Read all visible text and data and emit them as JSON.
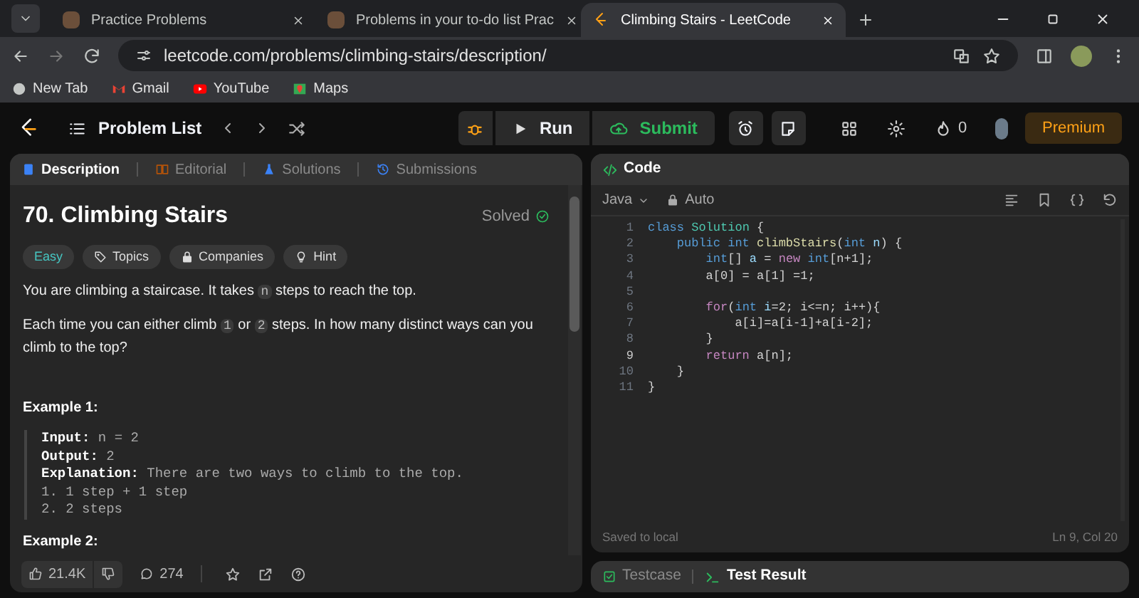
{
  "browser": {
    "tabs": [
      {
        "title": "Practice Problems",
        "selected": false
      },
      {
        "title": "Problems in your to-do list Prac",
        "selected": false
      },
      {
        "title": "Climbing Stairs - LeetCode",
        "selected": true
      }
    ],
    "url": "leetcode.com/problems/climbing-stairs/description/",
    "bookmarks": [
      {
        "label": "New Tab"
      },
      {
        "label": "Gmail"
      },
      {
        "label": "YouTube"
      },
      {
        "label": "Maps"
      }
    ]
  },
  "header": {
    "problem_list": "Problem List",
    "run": "Run",
    "submit": "Submit",
    "streak": "0",
    "premium": "Premium"
  },
  "left_panel": {
    "tabs": [
      {
        "label": "Description",
        "selected": true
      },
      {
        "label": "Editorial",
        "selected": false
      },
      {
        "label": "Solutions",
        "selected": false
      },
      {
        "label": "Submissions",
        "selected": false
      }
    ],
    "title": "70. Climbing Stairs",
    "status": "Solved",
    "chips": [
      {
        "label": "Easy",
        "kind": "difficulty"
      },
      {
        "label": "Topics",
        "kind": "tag"
      },
      {
        "label": "Companies",
        "kind": "lock"
      },
      {
        "label": "Hint",
        "kind": "bulb"
      }
    ],
    "paragraphs": [
      [
        {
          "t": "You are climbing a staircase. It takes "
        },
        {
          "t": "n",
          "code": true
        },
        {
          "t": " steps to reach the top."
        }
      ],
      [
        {
          "t": "Each time you can either climb "
        },
        {
          "t": "1",
          "code": true
        },
        {
          "t": " or "
        },
        {
          "t": "2",
          "code": true
        },
        {
          "t": " steps. In how many distinct ways can you climb to the top?"
        }
      ]
    ],
    "examples": [
      {
        "heading": "Example 1:",
        "lines": [
          {
            "label": "Input:",
            "value": "n = 2"
          },
          {
            "label": "Output:",
            "value": "2"
          },
          {
            "label": "Explanation:",
            "value": "There are two ways to climb to the top."
          },
          {
            "value": "1. 1 step + 1 step"
          },
          {
            "value": "2. 2 steps"
          }
        ]
      },
      {
        "heading": "Example 2:"
      }
    ],
    "footer": {
      "likes": "21.4K",
      "comments": "274"
    }
  },
  "code_panel": {
    "title": "Code",
    "language": "Java",
    "mode": "Auto",
    "lines": [
      {
        "number": "1",
        "tokens": [
          {
            "kind": "kw",
            "t": "class "
          },
          {
            "kind": "type",
            "t": "Solution"
          },
          {
            "kind": "p",
            "t": " {"
          }
        ]
      },
      {
        "number": "2",
        "tokens": [
          {
            "kind": "kw",
            "t": "    public int "
          },
          {
            "kind": "fn",
            "t": "climbStairs"
          },
          {
            "kind": "p",
            "t": "("
          },
          {
            "kind": "kw",
            "t": "int "
          },
          {
            "kind": "var",
            "t": "n"
          },
          {
            "kind": "p",
            "t": ") {"
          }
        ]
      },
      {
        "number": "3",
        "tokens": [
          {
            "kind": "kw",
            "t": "        int"
          },
          {
            "kind": "p",
            "t": "[] "
          },
          {
            "kind": "var",
            "t": "a"
          },
          {
            "kind": "p",
            "t": " = "
          },
          {
            "kind": "ctl",
            "t": "new "
          },
          {
            "kind": "kw",
            "t": "int"
          },
          {
            "kind": "p",
            "t": "[n+1];"
          }
        ]
      },
      {
        "number": "4",
        "tokens": [
          {
            "kind": "p",
            "t": "        a[0] = a[1] =1;"
          }
        ]
      },
      {
        "number": "5"
      },
      {
        "number": "6",
        "tokens": [
          {
            "kind": "ctl",
            "t": "        for"
          },
          {
            "kind": "p",
            "t": "("
          },
          {
            "kind": "kw",
            "t": "int "
          },
          {
            "kind": "var",
            "t": "i"
          },
          {
            "kind": "p",
            "t": "=2; i<=n; i++){"
          }
        ]
      },
      {
        "number": "7",
        "tokens": [
          {
            "kind": "p",
            "t": "            a[i]=a[i-1]+a[i-2];"
          }
        ]
      },
      {
        "number": "8",
        "tokens": [
          {
            "kind": "p",
            "t": "        }"
          }
        ]
      },
      {
        "number": "9",
        "current": true,
        "tokens": [
          {
            "kind": "ctl",
            "t": "        return "
          },
          {
            "kind": "p",
            "t": "a[n];"
          }
        ]
      },
      {
        "number": "10",
        "tokens": [
          {
            "kind": "p",
            "t": "    }"
          }
        ]
      },
      {
        "number": "11",
        "tokens": [
          {
            "kind": "p",
            "t": "}"
          }
        ]
      }
    ],
    "saved": "Saved to local",
    "cursor": "Ln 9, Col 20"
  },
  "bottom_tabs": [
    {
      "label": "Testcase",
      "selected": false
    },
    {
      "label": "Test Result",
      "selected": true
    }
  ]
}
